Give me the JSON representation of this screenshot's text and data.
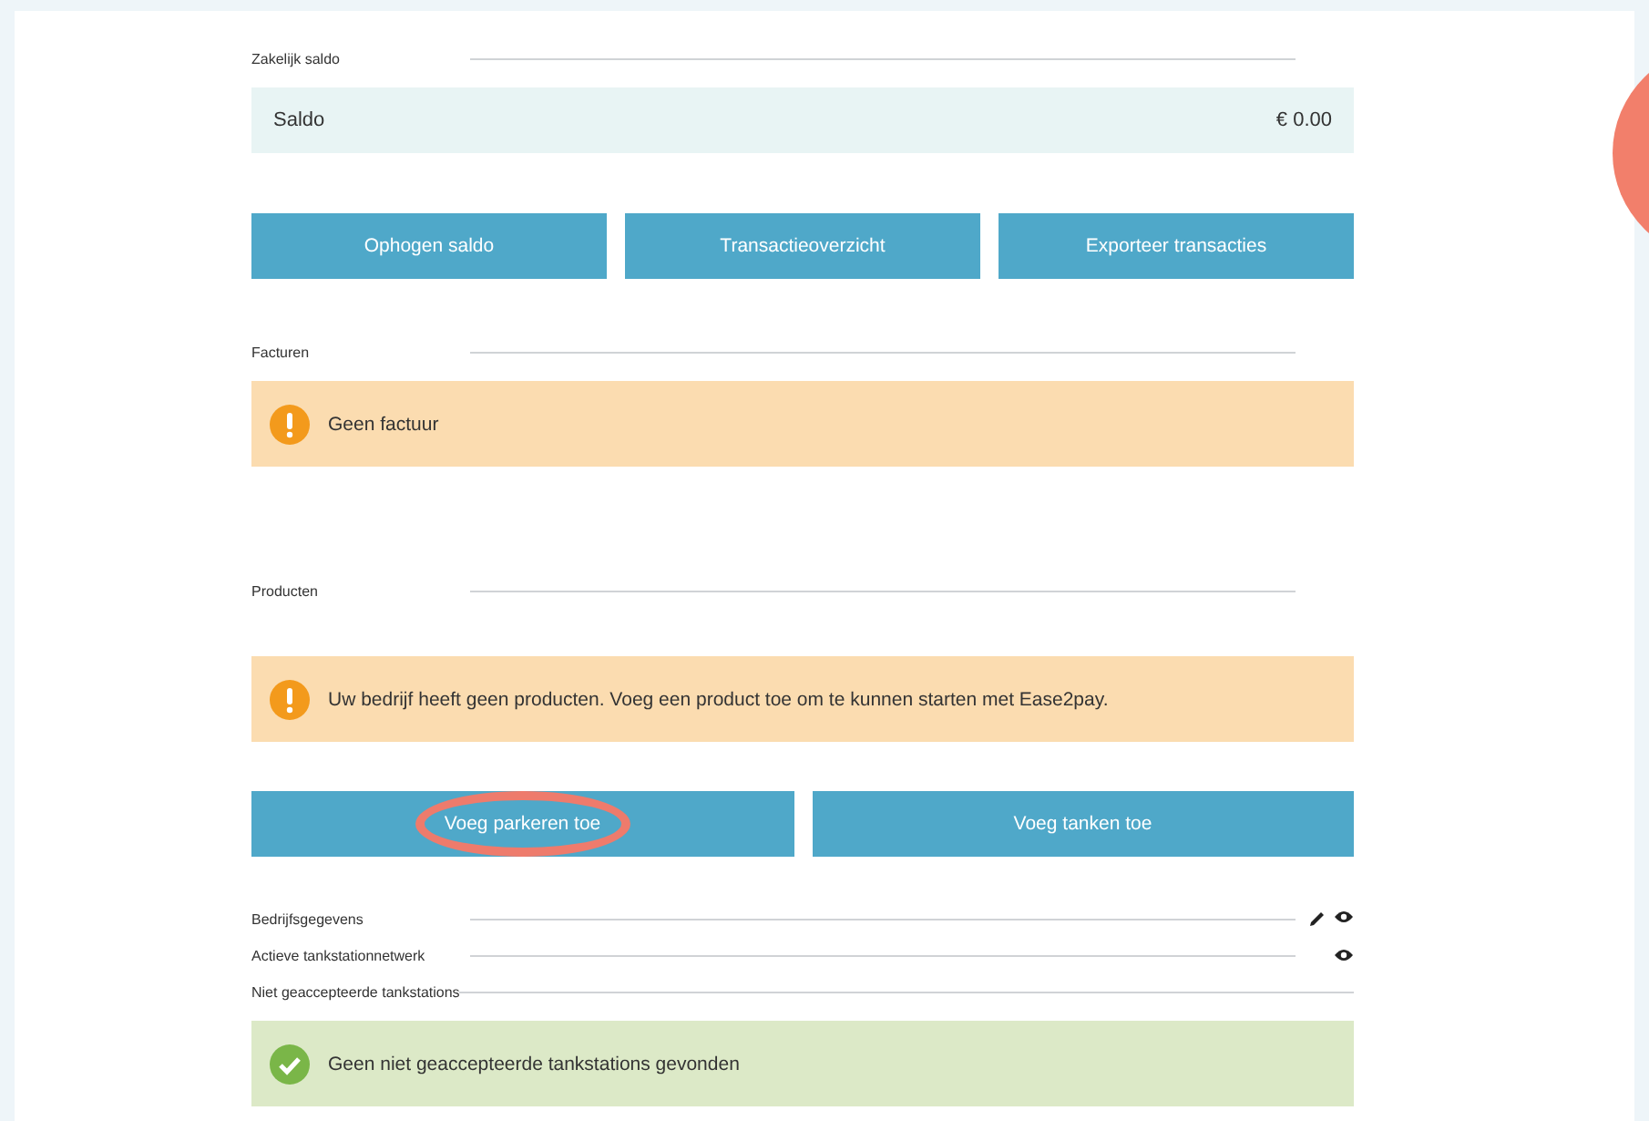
{
  "blocks": [
    {
      "kind": "heading",
      "label": "Zakelijk saldo"
    },
    {
      "kind": "balance",
      "label": "Saldo",
      "amount": "€ 0.00"
    },
    {
      "kind": "buttons",
      "buttons": [
        {
          "label": "Ophogen saldo",
          "highlighted": false
        },
        {
          "label": "Transactieoverzicht",
          "highlighted": false
        },
        {
          "label": "Exporteer transacties",
          "highlighted": false
        }
      ]
    },
    {
      "kind": "heading",
      "label": "Facturen"
    },
    {
      "kind": "warning",
      "text": "Geen factuur"
    },
    {
      "kind": "heading",
      "label": "Producten"
    },
    {
      "kind": "warning",
      "text": "Uw bedrijf heeft geen producten. Voeg een product toe om te kunnen starten met Ease2pay."
    },
    {
      "kind": "buttons",
      "buttons": [
        {
          "label": "Voeg parkeren toe",
          "highlighted": true
        },
        {
          "label": "Voeg tanken toe",
          "highlighted": false
        }
      ]
    },
    {
      "kind": "editable",
      "label": "Bedrijfsgegevens"
    },
    {
      "kind": "viewable",
      "label": "Actieve tankstationnetwerk"
    },
    {
      "kind": "fullrule",
      "label": "Niet geaccepteerde tankstations"
    },
    {
      "kind": "success",
      "text": "Geen niet geaccepteerde tankstations gevonden"
    }
  ]
}
